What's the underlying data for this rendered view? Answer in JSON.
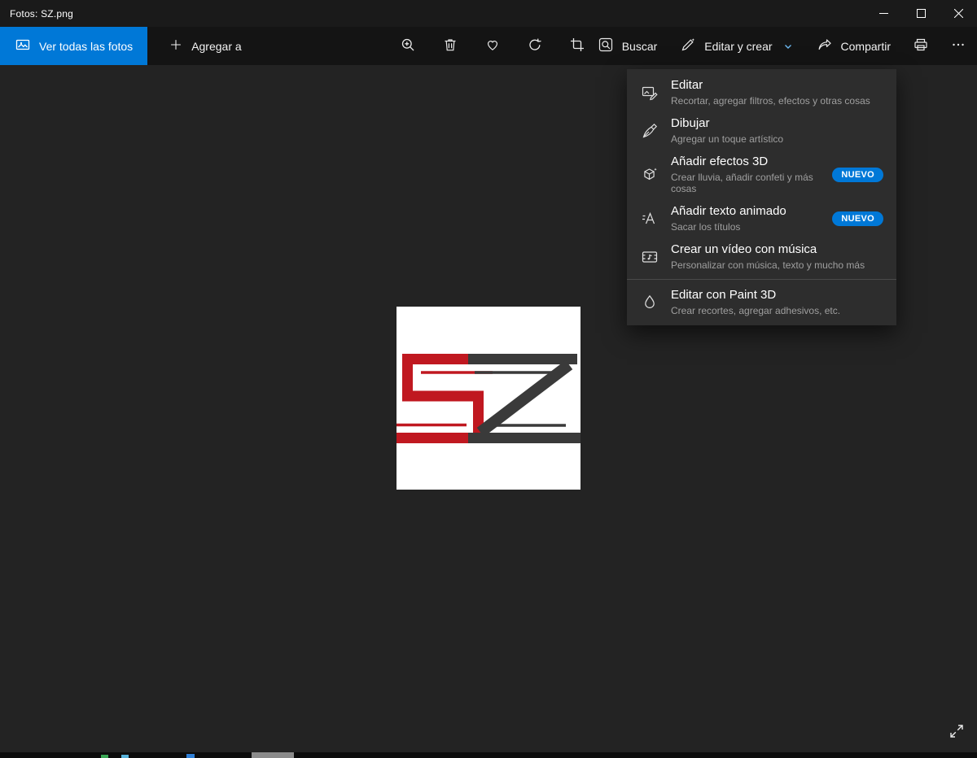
{
  "window": {
    "title": "Fotos: SZ.png"
  },
  "toolbar": {
    "view_all": "Ver todas las fotos",
    "add_to": "Agregar a",
    "search": "Buscar",
    "edit_create": "Editar y crear",
    "share": "Compartir"
  },
  "menu": {
    "items": [
      {
        "title": "Editar",
        "subtitle": "Recortar, agregar filtros, efectos y otras cosas",
        "icon": "edit-image-icon",
        "badge": ""
      },
      {
        "title": "Dibujar",
        "subtitle": "Agregar un toque artístico",
        "icon": "pen-icon",
        "badge": ""
      },
      {
        "title": "Añadir efectos 3D",
        "subtitle": "Crear lluvia, añadir confeti y más cosas",
        "icon": "3d-effects-icon",
        "badge": "NUEVO"
      },
      {
        "title": "Añadir texto animado",
        "subtitle": "Sacar los títulos",
        "icon": "animated-text-icon",
        "badge": "NUEVO"
      },
      {
        "title": "Crear un vídeo con música",
        "subtitle": "Personalizar con música, texto y mucho más",
        "icon": "video-music-icon",
        "badge": ""
      },
      {
        "title": "Editar con Paint 3D",
        "subtitle": "Crear recortes, agregar adhesivos, etc.",
        "icon": "paint-3d-icon",
        "badge": ""
      }
    ]
  },
  "photo": {
    "letters": "SZ"
  },
  "colors": {
    "accent": "#0078d7",
    "logo_red": "#c01820",
    "logo_dark": "#3a3a3a",
    "badge": "#0078d7"
  }
}
